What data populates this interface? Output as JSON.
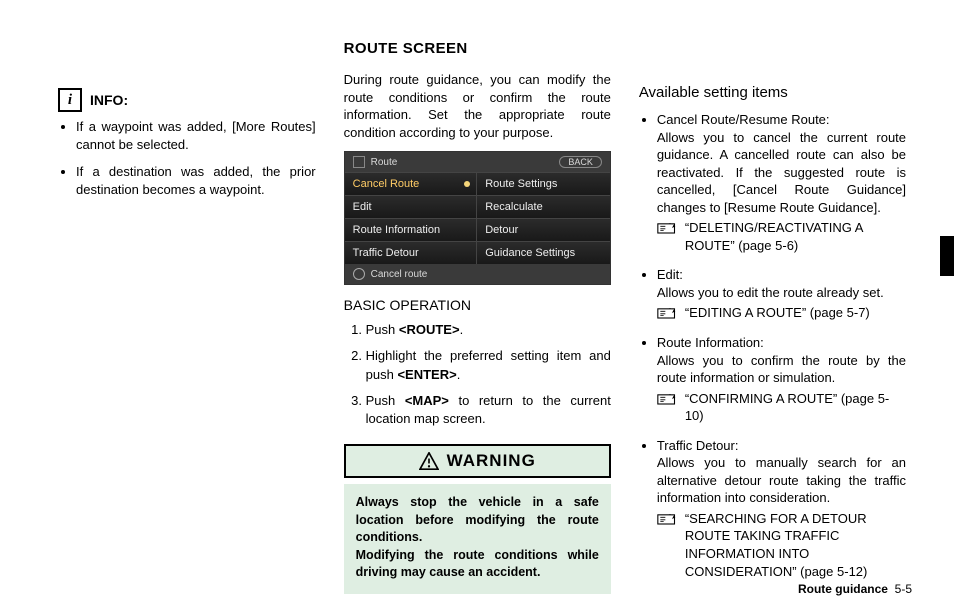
{
  "info": {
    "label": "INFO:",
    "bullets": [
      "If a waypoint was added, [More Routes] cannot be selected.",
      "If a destination was added, the prior destination becomes a waypoint."
    ]
  },
  "route_screen": {
    "title": "ROUTE SCREEN",
    "intro": "During route guidance, you can modify the route conditions or confirm the route information. Set the appropriate route condition according to your purpose.",
    "device": {
      "top_icon_label": "route-icon",
      "top_label": "Route",
      "back_label": "BACK",
      "cells": [
        "Cancel Route",
        "Route Settings",
        "Edit",
        "Recalculate",
        "Route Information",
        "Detour",
        "Traffic Detour",
        "Guidance Settings"
      ],
      "bottom_label": "Cancel route"
    },
    "basic_op": {
      "heading": "BASIC OPERATION",
      "steps_pre": [
        "Push ",
        "Highlight the preferred setting item and push ",
        "Push "
      ],
      "steps_key": [
        "<ROUTE>",
        "<ENTER>",
        "<MAP>"
      ],
      "steps_post": [
        ".",
        ".",
        " to return to the current location map screen."
      ]
    },
    "warning": {
      "heading": "WARNING",
      "body1": "Always stop the vehicle in a safe location before modifying the route conditions.",
      "body2": "Modifying the route conditions while driving may cause an accident."
    }
  },
  "settings": {
    "heading": "Available setting items",
    "items": [
      {
        "title": "Cancel Route/Resume Route:",
        "desc": "Allows you to cancel the current route guidance. A cancelled route can also be reactivated. If the suggested route is cancelled, [Cancel Route Guidance] changes to [Resume Route Guidance].",
        "xref": "“DELETING/REACTIVATING A ROUTE” (page 5-6)"
      },
      {
        "title": "Edit:",
        "desc": "Allows you to edit the route already set.",
        "xref": "“EDITING A ROUTE” (page 5-7)"
      },
      {
        "title": "Route Information:",
        "desc": "Allows you to confirm the route by the route information or simulation.",
        "xref": "“CONFIRMING A ROUTE” (page 5-10)"
      },
      {
        "title": "Traffic Detour:",
        "desc": "Allows you to manually search for an alternative detour route taking the traffic information into consideration.",
        "xref": "“SEARCHING FOR A DETOUR ROUTE TAKING TRAFFIC INFORMATION INTO CONSIDERATION” (page 5-12)"
      }
    ]
  },
  "footer": {
    "section": "Route guidance",
    "page": "5-5"
  }
}
